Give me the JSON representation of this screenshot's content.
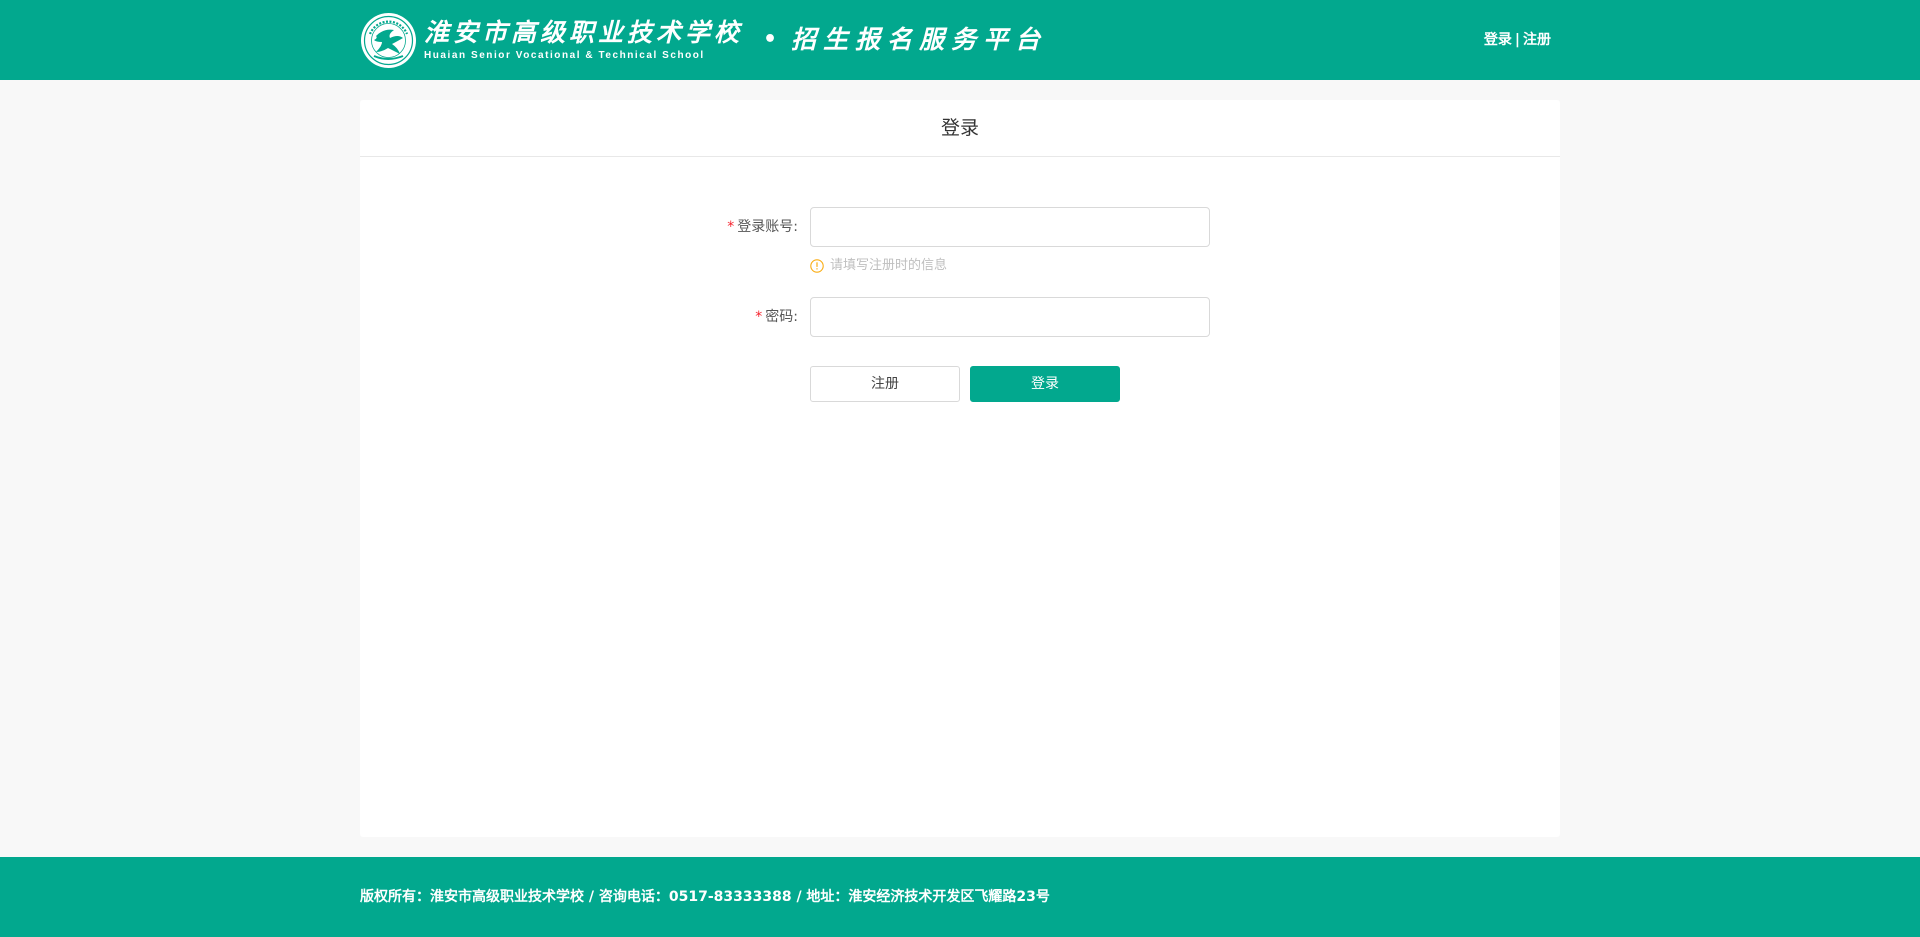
{
  "header": {
    "school_name_cn": "淮安市高级职业技术学校",
    "school_name_en": "Huaian Senior Vocational & Technical School",
    "separator": "•",
    "platform_title": "招生报名服务平台",
    "login_link": "登录",
    "link_separator": "|",
    "register_link": "注册"
  },
  "login_card": {
    "title": "登录",
    "account": {
      "required_mark": "*",
      "label": "登录账号:",
      "value": "",
      "placeholder": "",
      "hint": "请填写注册时的信息",
      "hint_icon": "info-circle-icon"
    },
    "password": {
      "required_mark": "*",
      "label": "密码:",
      "value": "",
      "placeholder": ""
    },
    "register_button": "注册",
    "login_button": "登录"
  },
  "footer": {
    "text": "版权所有：淮安市高级职业技术学校 / 咨询电话：0517-83333388 / 地址：淮安经济技术开发区飞耀路23号"
  },
  "colors": {
    "brand": "#02a88e",
    "page_background": "#f8f8f8",
    "card_background": "#ffffff",
    "required": "#f5222d",
    "hint_icon": "#faad14"
  }
}
